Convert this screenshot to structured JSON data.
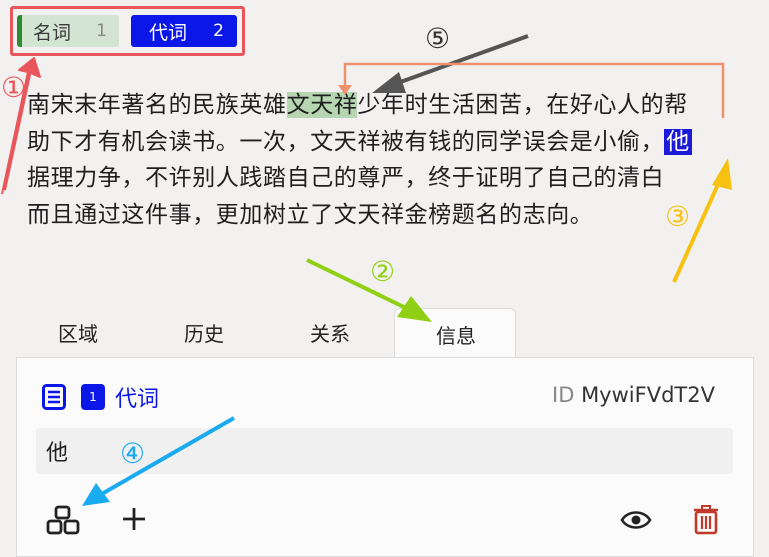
{
  "labels": [
    {
      "name": "名词",
      "count": "1",
      "color": "#2e8b2e"
    },
    {
      "name": "代词",
      "count": "2",
      "color": "#0a17e6"
    }
  ],
  "text": {
    "lines": [
      {
        "pre": "南宋末年著名的民族英雄",
        "highlight": "文天祥",
        "post": "少年时生活困苦，在好心人的帮"
      },
      {
        "pre": "助下才有机会读书。一次，文天祥被有钱的同学误会是小偷，",
        "highlight": "他",
        "post": ""
      },
      {
        "pre": "据理力争，不许别人践踏自己的尊严，终于证明了自己的清白",
        "highlight": "",
        "post": ""
      },
      {
        "pre": "而且通过这件事，更加树立了文天祥金榜题名的志向。",
        "highlight": "",
        "post": ""
      }
    ]
  },
  "tabs": [
    "区域",
    "历史",
    "关系",
    "信息"
  ],
  "info": {
    "badge_number": "1",
    "label_name": "代词",
    "id_prefix": "ID",
    "id_value": "MywiFVdT2V",
    "value": "他"
  },
  "annotations": [
    "①",
    "②",
    "③",
    "④",
    "⑤"
  ],
  "colors": {
    "noun": "#2e8b2e",
    "pronoun": "#0a17e6",
    "annotation_red": "#e8565c",
    "annotation_green": "#8fd014",
    "annotation_yellow": "#f7c112",
    "annotation_blue": "#1aaaf0",
    "annotation_salmon": "#f0916e"
  }
}
